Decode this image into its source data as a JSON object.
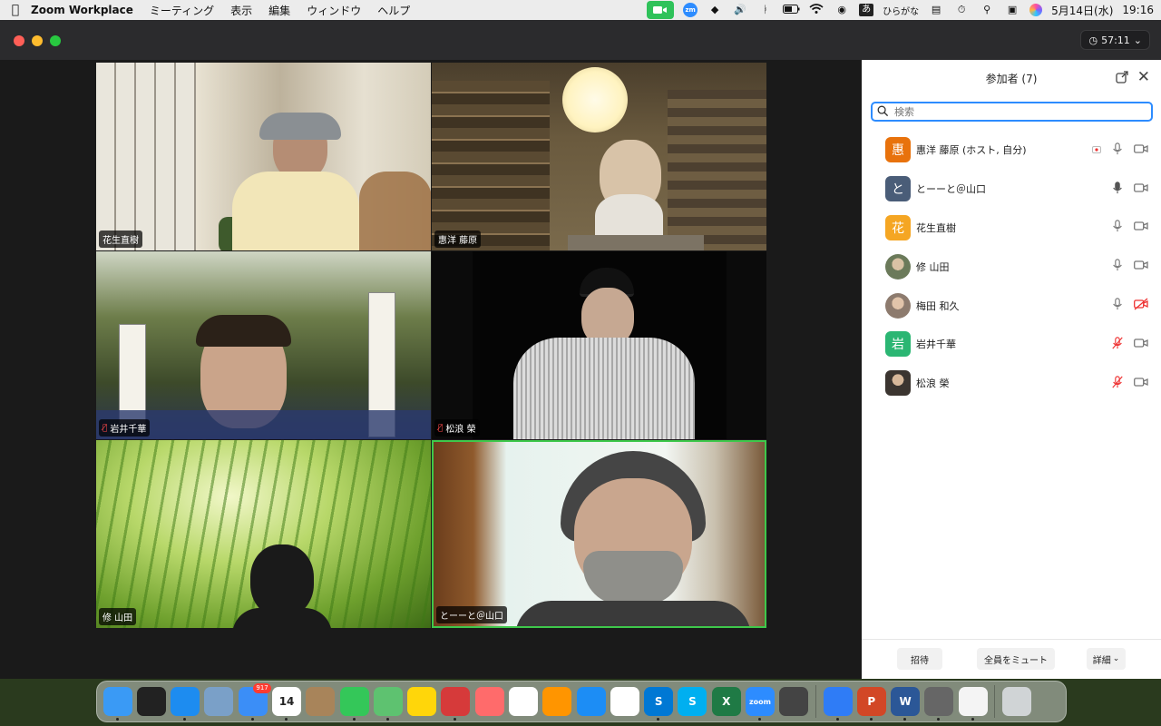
{
  "menubar": {
    "app_name": "Zoom Workplace",
    "menus": [
      "ミーティング",
      "表示",
      "編集",
      "ウィンドウ",
      "ヘルプ"
    ],
    "ime_label": "あ",
    "ime_mode": "ひらがな",
    "date": "5月14日(水)",
    "time": "19:16",
    "zoom_icon_label": "zm"
  },
  "window": {
    "timer": "57:11",
    "accent_color": "#2d8cff",
    "active_speaker_color": "#3ec84b"
  },
  "tiles": [
    {
      "name": "花生直樹",
      "muted": false
    },
    {
      "name": "惠洋 藤原",
      "muted": false
    },
    {
      "name": "岩井千華",
      "muted": true
    },
    {
      "name": "松浪 榮",
      "muted": true
    },
    {
      "name": "修 山田",
      "muted": false
    },
    {
      "name": "とーーと＠山口",
      "muted": false,
      "active_speaker": true
    }
  ],
  "panel": {
    "title": "参加者 (7)",
    "search_placeholder": "検索",
    "participants": [
      {
        "name": "惠洋 藤原 (ホスト, 自分)",
        "avatar_char": "惠",
        "avatar_color": "#e8720c",
        "mic": "on",
        "video": "on",
        "recording": true
      },
      {
        "name": "とーーと＠山口",
        "avatar_char": "と",
        "avatar_color": "#4a5d78",
        "mic": "on-dark",
        "video": "on"
      },
      {
        "name": "花生直樹",
        "avatar_char": "花",
        "avatar_color": "#f5a623",
        "mic": "on",
        "video": "on"
      },
      {
        "name": "修 山田",
        "avatar_char": "",
        "avatar_color": "#7c8a6e",
        "mic": "on",
        "video": "on"
      },
      {
        "name": "梅田 和久",
        "avatar_char": "",
        "avatar_color": "#8d7b6e",
        "mic": "on",
        "video": "off"
      },
      {
        "name": "岩井千華",
        "avatar_char": "岩",
        "avatar_color": "#2bb673",
        "mic": "muted",
        "video": "on"
      },
      {
        "name": "松浪 榮",
        "avatar_char": "",
        "avatar_color": "#5b5046",
        "mic": "muted",
        "video": "on"
      }
    ],
    "footer": {
      "invite": "招待",
      "mute_all": "全員をミュート",
      "more": "詳細"
    }
  },
  "dock": {
    "apps": [
      {
        "name": "finder",
        "color": "#3a9af5",
        "label": "",
        "running": true
      },
      {
        "name": "mission-control",
        "color": "#222222",
        "label": ""
      },
      {
        "name": "safari",
        "color": "#1d8cf0",
        "label": "",
        "running": true
      },
      {
        "name": "preview",
        "color": "#7aa0c8",
        "label": ""
      },
      {
        "name": "mail",
        "color": "#3b8ef7",
        "label": "",
        "badge": "917",
        "running": true
      },
      {
        "name": "calendar",
        "color": "#ffffff",
        "label": "14",
        "running": true
      },
      {
        "name": "contacts",
        "color": "#a8845a",
        "label": ""
      },
      {
        "name": "messages",
        "color": "#34c759",
        "label": "",
        "running": true
      },
      {
        "name": "maps",
        "color": "#5ec270",
        "label": "",
        "running": true
      },
      {
        "name": "notes",
        "color": "#ffd60a",
        "label": ""
      },
      {
        "name": "photo-booth",
        "color": "#d63a3a",
        "label": "",
        "running": true
      },
      {
        "name": "launchpad",
        "color": "#ff6b6b",
        "label": ""
      },
      {
        "name": "photos",
        "color": "#ffffff",
        "label": ""
      },
      {
        "name": "books",
        "color": "#ff9500",
        "label": ""
      },
      {
        "name": "app-store",
        "color": "#1c8df5",
        "label": ""
      },
      {
        "name": "reminders",
        "color": "#ffffff",
        "label": ""
      },
      {
        "name": "skype-business",
        "color": "#0078d4",
        "label": "S",
        "running": true
      },
      {
        "name": "skype",
        "color": "#00aff0",
        "label": "S"
      },
      {
        "name": "excel",
        "color": "#1f7a45",
        "label": "X"
      },
      {
        "name": "zoom",
        "color": "#2d8cff",
        "label": "zoom",
        "running": true
      },
      {
        "name": "google-drive",
        "color": "#444444",
        "label": ""
      },
      {
        "name": "messenger",
        "color": "#2f7cf6",
        "label": "",
        "running": true
      },
      {
        "name": "powerpoint",
        "color": "#d24726",
        "label": "P",
        "running": true
      },
      {
        "name": "word",
        "color": "#2b5797",
        "label": "W",
        "running": true
      },
      {
        "name": "printer",
        "color": "#666666",
        "label": "",
        "running": true
      },
      {
        "name": "chrome",
        "color": "#f4f4f4",
        "label": "",
        "running": true
      },
      {
        "name": "trash",
        "color": "#d0d4d6",
        "label": ""
      }
    ]
  }
}
